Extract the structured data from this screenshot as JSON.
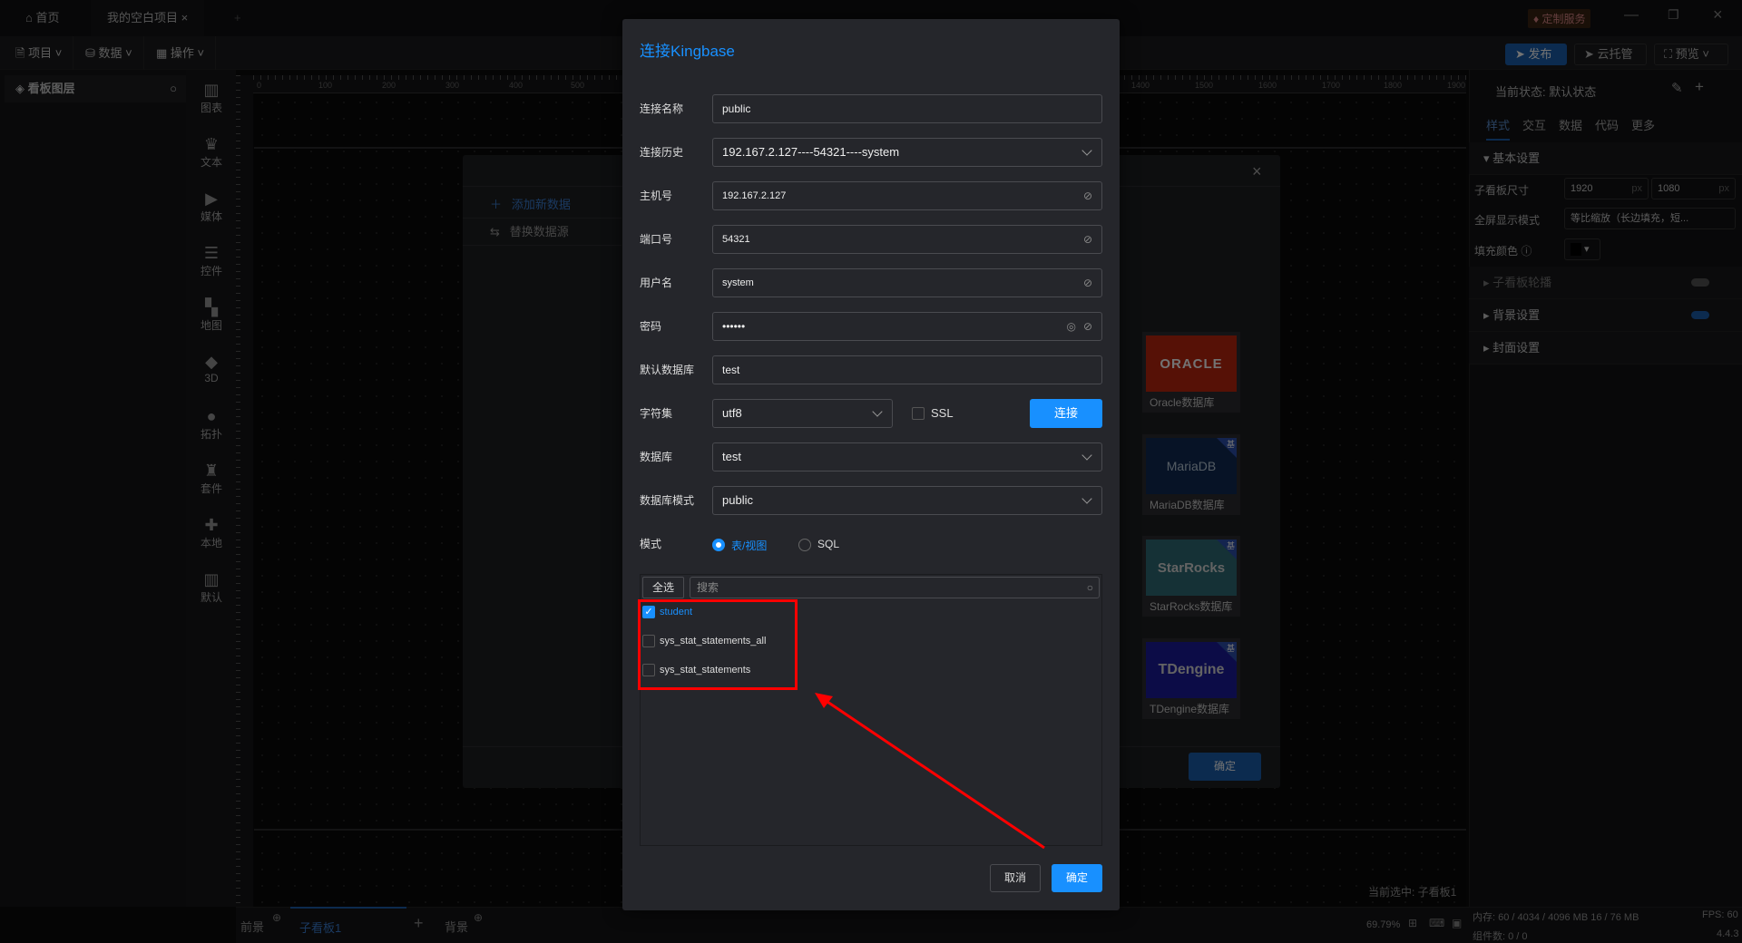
{
  "titlebar": {
    "home": "首页",
    "project_tab": "我的空白项目",
    "custom_service": "定制服务"
  },
  "toolbar": {
    "menus": [
      "项目",
      "数据",
      "操作"
    ],
    "publish": "发布",
    "cloud": "云托管",
    "preview": "预览"
  },
  "layers": {
    "title": "看板图层"
  },
  "components": [
    "图表",
    "文本",
    "媒体",
    "控件",
    "地图",
    "3D",
    "拓扑",
    "套件",
    "本地",
    "默认"
  ],
  "ruler": {
    "top": [
      "0",
      "100",
      "200",
      "300",
      "400",
      "500",
      "1400",
      "1500",
      "1600",
      "1700",
      "1800",
      "1900"
    ]
  },
  "right_panel": {
    "state_label": "当前状态:",
    "state_value": "默认状态",
    "tabs": [
      "样式",
      "交互",
      "数据",
      "代码",
      "更多"
    ],
    "basic": "基本设置",
    "size_label": "子看板尺寸",
    "width": "1920",
    "height": "1080",
    "unit": "px",
    "fullscreen_label": "全屏显示模式",
    "fullscreen_value": "等比缩放（长边填充，短...",
    "fill_label": "填充颜色",
    "carousel": "子看板轮播",
    "background": "背景设置",
    "cover": "封面设置"
  },
  "bottom": {
    "front": "前景",
    "board": "子看板1",
    "back": "背景",
    "selected": "当前选中: 子看板1",
    "zoom": "69.79%",
    "memory": "内存:  60 / 4034 / 4096 MB  16 / 76 MB",
    "fps": "FPS:  60",
    "components": "组件数: 0 / 0",
    "version": "4.4.3"
  },
  "bg_modal": {
    "add_new": "添加新数据",
    "replace": "替换数据源",
    "confirm": "确定",
    "cards": [
      {
        "logo": "ORACLE",
        "caption": "Oracle数据库",
        "color": "#c0260e"
      },
      {
        "logo": "MariaDB",
        "caption": "MariaDB数据库",
        "color": "#0f2a55",
        "badge": "基"
      },
      {
        "logo": "StarRocks",
        "caption": "StarRocks数据库",
        "color": "#2e6d78",
        "badge": "基"
      },
      {
        "logo": "TDengine",
        "caption": "TDengine数据库",
        "color": "#1b1a9e",
        "badge": "基"
      }
    ]
  },
  "dialog": {
    "title": "连接Kingbase",
    "fields": [
      {
        "label": "连接名称",
        "value": "public"
      },
      {
        "label": "连接历史",
        "value": "192.167.2.127----54321----system"
      },
      {
        "label": "主机号",
        "value": "192.167.2.127"
      },
      {
        "label": "端口号",
        "value": "54321"
      },
      {
        "label": "用户名",
        "value": "system"
      },
      {
        "label": "密码",
        "value": "••••••"
      },
      {
        "label": "默认数据库",
        "value": "test"
      },
      {
        "label": "字符集",
        "value": "utf8"
      },
      {
        "label": "数据库",
        "value": "test"
      },
      {
        "label": "数据库模式",
        "value": "public"
      }
    ],
    "ssl": "SSL",
    "connect": "连接",
    "mode_label": "模式",
    "mode_table": "表/视图",
    "mode_sql": "SQL",
    "select_all": "全选",
    "search_placeholder": "搜索",
    "tables": [
      {
        "name": "student",
        "checked": true
      },
      {
        "name": "sys_stat_statements_all",
        "checked": false
      },
      {
        "name": "sys_stat_statements",
        "checked": false
      }
    ],
    "cancel": "取消",
    "ok": "确定"
  }
}
